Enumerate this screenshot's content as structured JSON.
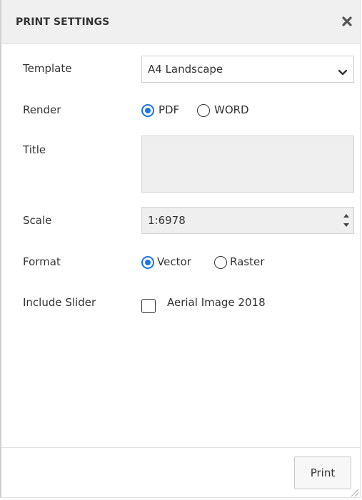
{
  "header": {
    "title": "PRINT SETTINGS",
    "close_icon": "close-icon"
  },
  "template": {
    "label": "Template",
    "value": "A4 Landscape",
    "chevron_icon": "chevron-down-icon"
  },
  "render": {
    "label": "Render",
    "options": [
      {
        "label": "PDF",
        "checked": true
      },
      {
        "label": "WORD",
        "checked": false
      }
    ]
  },
  "title_field": {
    "label": "Title",
    "value": ""
  },
  "scale": {
    "label": "Scale",
    "value": "1:6978"
  },
  "format": {
    "label": "Format",
    "options": [
      {
        "label": "Vector",
        "checked": true
      },
      {
        "label": "Raster",
        "checked": false
      }
    ]
  },
  "include_slider": {
    "label": "Include Slider",
    "option_label": "Aerial Image 2018",
    "checked": false
  },
  "footer": {
    "print_label": "Print"
  },
  "colors": {
    "accent": "#1a73e8",
    "header_bg": "#f0f0f0",
    "disabled_bg": "#efefef"
  }
}
